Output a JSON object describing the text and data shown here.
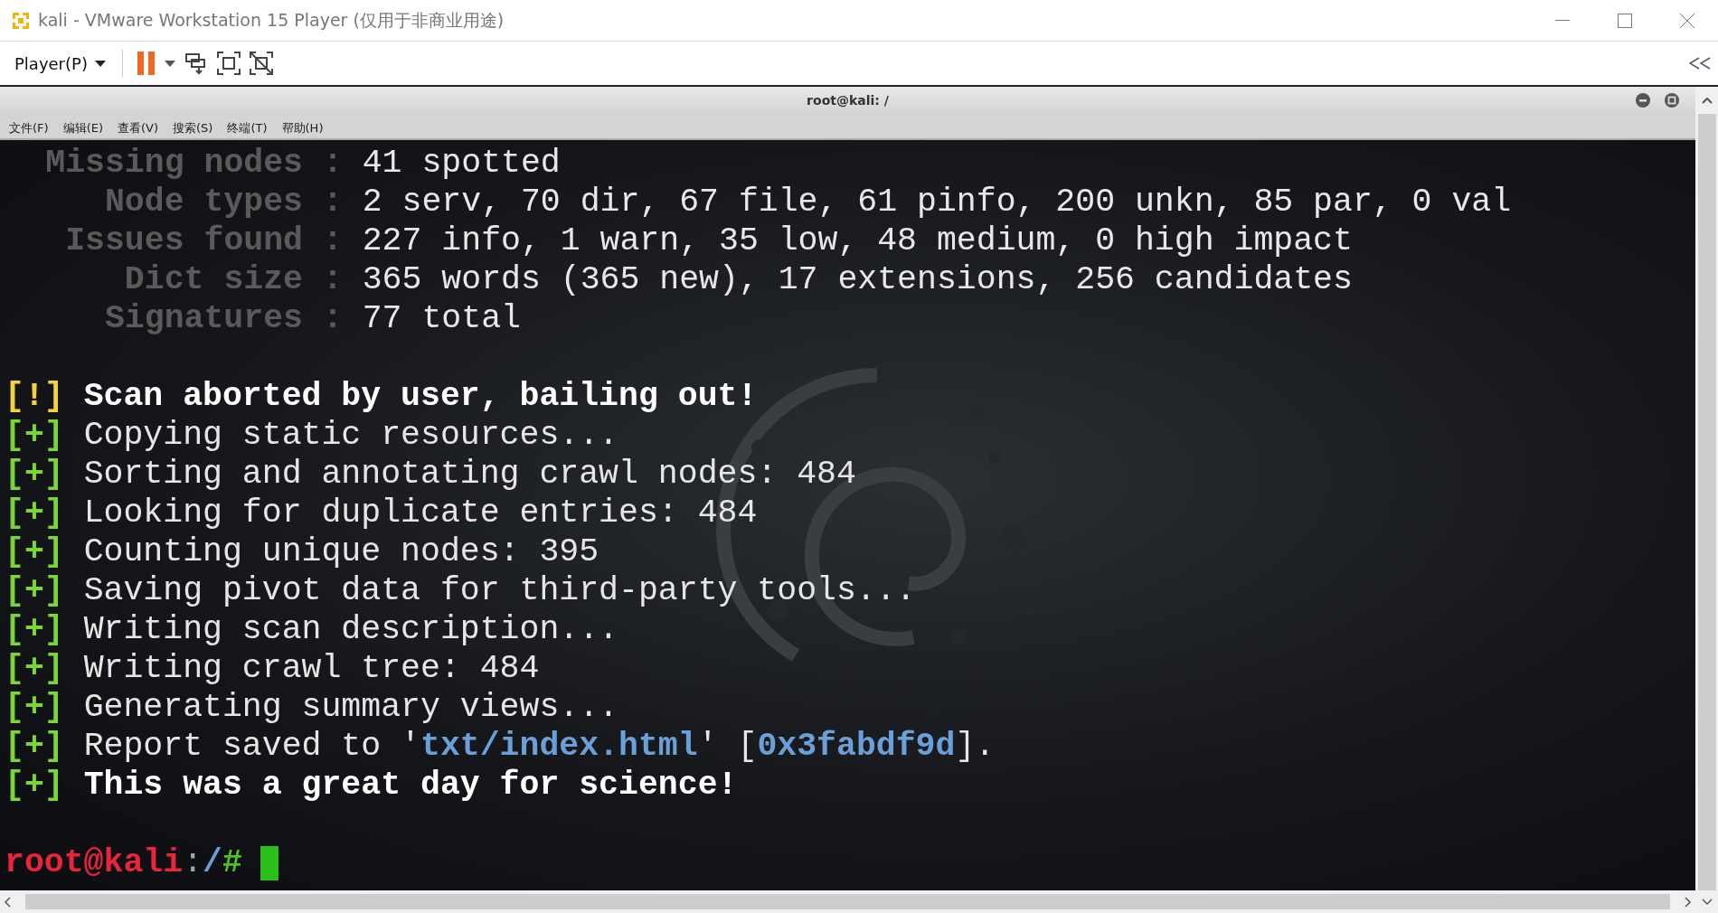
{
  "window": {
    "title": "kali - VMware Workstation 15 Player (仅用于非商业用途)"
  },
  "toolbar": {
    "player_menu": "Player(P)"
  },
  "terminal": {
    "title": "root@kali: /",
    "menu": [
      "文件(F)",
      "编辑(E)",
      "查看(V)",
      "搜索(S)",
      "终端(T)",
      "帮助(H)"
    ],
    "stats": [
      {
        "label": "Missing nodes",
        "sep": ":",
        "value": "41 spotted"
      },
      {
        "label": "Node types",
        "sep": ":",
        "value": "2 serv, 70 dir, 67 file, 61 pinfo, 200 unkn, 85 par, 0 val"
      },
      {
        "label": "Issues found",
        "sep": ":",
        "value": "227 info, 1 warn, 35 low, 48 medium, 0 high impact"
      },
      {
        "label": "Dict size",
        "sep": ":",
        "value": "365 words (365 new), 17 extensions, 256 candidates"
      },
      {
        "label": "Signatures",
        "sep": ":",
        "value": "77 total"
      }
    ],
    "log": [
      {
        "marker": "[!]",
        "kind": "warning",
        "parts": [
          {
            "text": "Scan aborted by user, bailing out!",
            "kind": "bold"
          }
        ]
      },
      {
        "marker": "[+]",
        "kind": "info",
        "parts": [
          {
            "text": "Copying static resources...",
            "kind": "plain"
          }
        ]
      },
      {
        "marker": "[+]",
        "kind": "info",
        "parts": [
          {
            "text": "Sorting and annotating crawl nodes: 484",
            "kind": "plain"
          }
        ]
      },
      {
        "marker": "[+]",
        "kind": "info",
        "parts": [
          {
            "text": "Looking for duplicate entries: 484",
            "kind": "plain"
          }
        ]
      },
      {
        "marker": "[+]",
        "kind": "info",
        "parts": [
          {
            "text": "Counting unique nodes: 395",
            "kind": "plain"
          }
        ]
      },
      {
        "marker": "[+]",
        "kind": "info",
        "parts": [
          {
            "text": "Saving pivot data for third-party tools...",
            "kind": "plain"
          }
        ]
      },
      {
        "marker": "[+]",
        "kind": "info",
        "parts": [
          {
            "text": "Writing scan description...",
            "kind": "plain"
          }
        ]
      },
      {
        "marker": "[+]",
        "kind": "info",
        "parts": [
          {
            "text": "Writing crawl tree: 484",
            "kind": "plain"
          }
        ]
      },
      {
        "marker": "[+]",
        "kind": "info",
        "parts": [
          {
            "text": "Generating summary views...",
            "kind": "plain"
          }
        ]
      },
      {
        "marker": "[+]",
        "kind": "info",
        "parts": [
          {
            "text": "Report saved to '",
            "kind": "plain"
          },
          {
            "text": "txt/index.html",
            "kind": "link"
          },
          {
            "text": "' [",
            "kind": "plain"
          },
          {
            "text": "0x3fabdf9d",
            "kind": "link"
          },
          {
            "text": "].",
            "kind": "plain"
          }
        ]
      },
      {
        "marker": "[+]",
        "kind": "info",
        "parts": [
          {
            "text": "This was a great day for science!",
            "kind": "bold"
          }
        ]
      }
    ],
    "prompt": {
      "user": "root@kali",
      "sep": ":",
      "path": "/",
      "symbol": "#"
    }
  }
}
